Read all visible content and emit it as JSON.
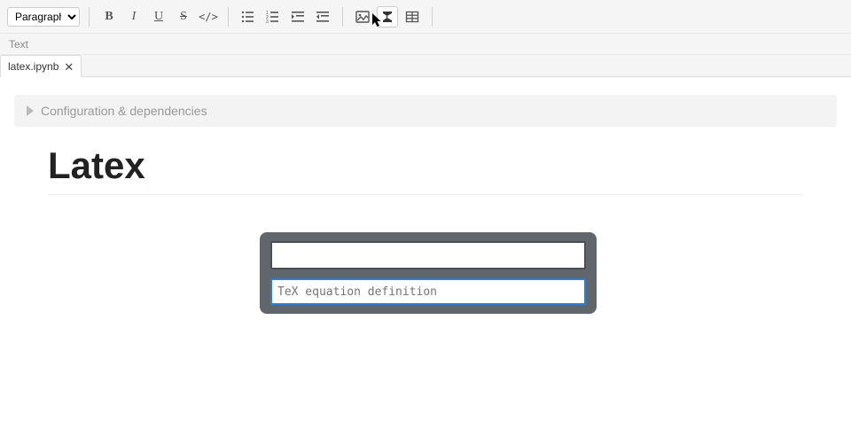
{
  "toolbar": {
    "format_select": "Paragraph",
    "buttons": {
      "bold": "B",
      "italic": "I",
      "underline": "U",
      "strike": "S",
      "code": "</>"
    }
  },
  "subbar": {
    "label": "Text"
  },
  "tab": {
    "title": "latex.ipynb",
    "close": "✕"
  },
  "collapse": {
    "label": "Configuration & dependencies"
  },
  "heading": "Latex",
  "latex_popup": {
    "placeholder": "TeX equation definition"
  }
}
